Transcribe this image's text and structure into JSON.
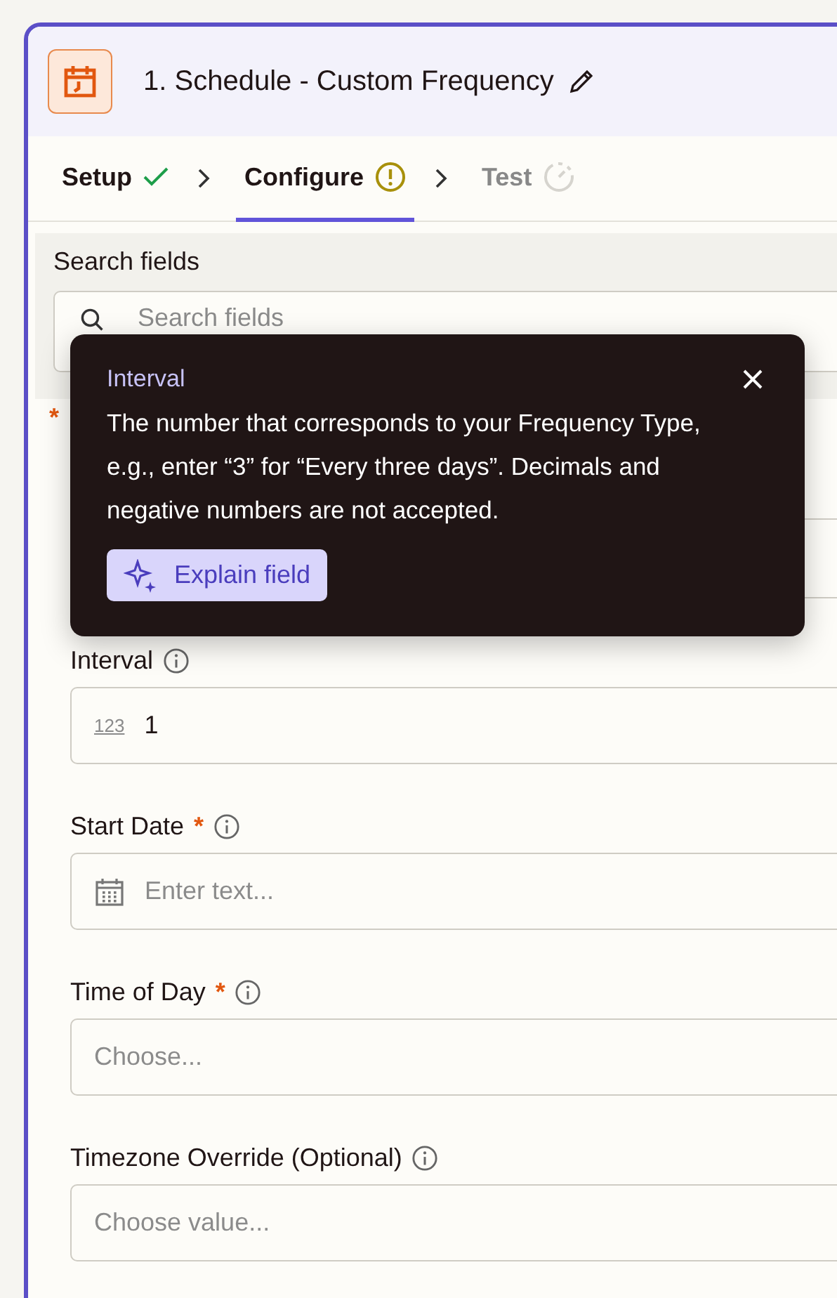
{
  "step": {
    "title": "1. Schedule - Custom Frequency"
  },
  "tabs": [
    {
      "label": "Setup",
      "selected": false,
      "disabled": false,
      "kind": "done"
    },
    {
      "label": "Configure",
      "selected": true,
      "disabled": false,
      "kind": "warning"
    },
    {
      "label": "Test",
      "selected": false,
      "disabled": true,
      "kind": "pending"
    }
  ],
  "search": {
    "label": "Search fields",
    "placeholder": "Search fields"
  },
  "required_mark": "*",
  "fields": [
    {
      "label": "Interval",
      "required": false,
      "kind": "number",
      "badge": "123",
      "value": "1"
    },
    {
      "label": "Start Date",
      "required": true,
      "kind": "date",
      "placeholder": "Enter text..."
    },
    {
      "label": "Time of Day",
      "required": true,
      "kind": "select",
      "placeholder": "Choose..."
    },
    {
      "label": "Timezone Override (Optional)",
      "required": false,
      "kind": "select",
      "placeholder": "Choose value..."
    }
  ],
  "tooltip": {
    "title": "Interval",
    "body": "The number that corresponds to your Frequency Type, e.g., enter “3” for “Every three days”. Decimals and negative numbers are not accepted.",
    "button": "Explain field"
  }
}
